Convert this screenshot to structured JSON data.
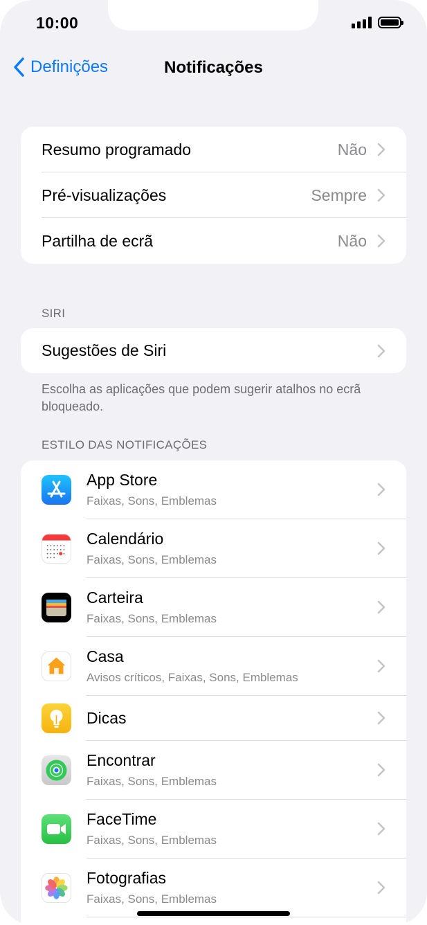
{
  "status_bar": {
    "time": "10:00"
  },
  "nav": {
    "back_label": "Definições",
    "title": "Notificações"
  },
  "general": [
    {
      "label": "Resumo programado",
      "value": "Não"
    },
    {
      "label": "Pré-visualizações",
      "value": "Sempre"
    },
    {
      "label": "Partilha de ecrã",
      "value": "Não"
    }
  ],
  "siri": {
    "header": "SIRI",
    "row_label": "Sugestões de Siri",
    "footer": "Escolha as aplicações que podem sugerir atalhos no ecrã bloqueado."
  },
  "notifications_style": {
    "header": "ESTILO DAS NOTIFICAÇÕES",
    "apps": [
      {
        "name": "App Store",
        "subtitle": "Faixas, Sons, Emblemas",
        "icon": "app-store-icon"
      },
      {
        "name": "Calendário",
        "subtitle": "Faixas, Sons, Emblemas",
        "icon": "calendar-icon"
      },
      {
        "name": "Carteira",
        "subtitle": "Faixas, Sons, Emblemas",
        "icon": "wallet-icon"
      },
      {
        "name": "Casa",
        "subtitle": "Avisos críticos, Faixas, Sons, Emblemas",
        "icon": "home-app-icon"
      },
      {
        "name": "Dicas",
        "subtitle": "",
        "icon": "tips-icon"
      },
      {
        "name": "Encontrar",
        "subtitle": "Faixas, Sons, Emblemas",
        "icon": "find-my-icon"
      },
      {
        "name": "FaceTime",
        "subtitle": "Faixas, Sons, Emblemas",
        "icon": "facetime-icon"
      },
      {
        "name": "Fotografias",
        "subtitle": "Faixas, Sons, Emblemas",
        "icon": "photos-icon"
      }
    ]
  },
  "colors": {
    "accent": "#0a7aff",
    "background": "#f2f1f6",
    "secondary_text": "#8a8a8e"
  }
}
